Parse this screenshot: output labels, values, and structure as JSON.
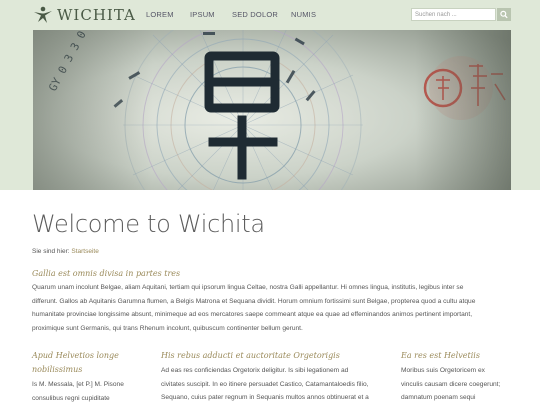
{
  "header": {
    "logo_text": "WICHITA",
    "nav": [
      "LOREM",
      "IPSUM",
      "SED DOLOR",
      "NUMIS"
    ],
    "search_placeholder": "Suchen nach ..."
  },
  "page": {
    "title": "Welcome to Wichita",
    "breadcrumb_prefix": "Sie sind hier:",
    "breadcrumb_link": "Startseite"
  },
  "intro": {
    "heading": "Gallia est omnis divisa in partes tres",
    "lines": [
      "Quarum unam incolunt Belgae, aliam Aquitani, tertiam qui ipsorum lingua Celtae, nostra Galli appellantur. Hi omnes lingua, institutis, legibus inter se",
      "differunt. Gallos ab Aquitanis Garumna flumen, a Belgis Matrona et Sequana dividit. Horum omnium fortissimi sunt Belgae, propterea quod a cultu atque",
      "humanitate provinciae longissime absunt, minimeque ad eos mercatores saepe commeant atque ea quae ad effeminandos animos pertinent important,",
      "proximique sunt Germanis, qui trans Rhenum incolunt, quibuscum continenter bellum gerunt."
    ]
  },
  "columns": [
    {
      "heading_lines": [
        "Apud Helvetios longe",
        "nobilissimus"
      ],
      "lines": [
        "Is M. Messala, [et P.] M. Pisone",
        "consulibus regni cupiditate"
      ]
    },
    {
      "heading_lines": [
        "His rebus adducti et auctoritate Orgetorigis"
      ],
      "lines": [
        "Ad eas res conficiendas Orgetorix deligitur. Is sibi legationem ad",
        "civitates suscipit. In eo itinere persuadet Castico, Catamantaloedis filio,",
        "Sequano, cuius pater regnum in Sequanis multos annos obtinuerat et a"
      ]
    },
    {
      "heading_lines": [
        "Ea res est Helvetiis"
      ],
      "lines": [
        "Moribus suis Orgetoricem ex",
        "vinculis causam dicere coegerunt;",
        "damnatum poenam sequi"
      ]
    }
  ]
}
